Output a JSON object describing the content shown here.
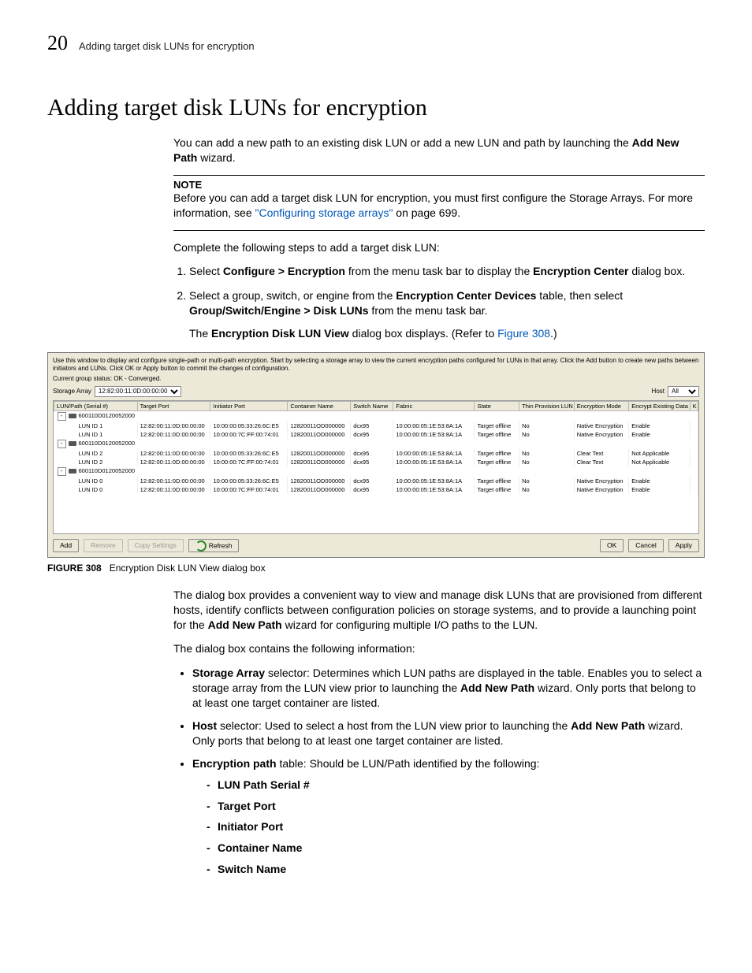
{
  "header": {
    "page_number": "20",
    "crumb": "Adding target disk LUNs for encryption"
  },
  "title": "Adding target disk LUNs for encryption",
  "intro": {
    "p1_a": "You can add a new path to an existing disk LUN or add a new LUN and path by launching the ",
    "p1_b": "Add New Path",
    "p1_c": " wizard."
  },
  "note": {
    "label": "NOTE",
    "text_a": "Before you can add a target disk LUN for encryption, you must first configure the Storage Arrays. For more information, see ",
    "link": "\"Configuring storage arrays\"",
    "text_b": " on page 699."
  },
  "complete": "Complete the following steps to add a target disk LUN:",
  "steps": {
    "s1_a": "Select ",
    "s1_b": "Configure > Encryption",
    "s1_c": " from the menu task bar to display the ",
    "s1_d": "Encryption Center",
    "s1_e": " dialog box.",
    "s2_a": "Select a group, switch, or engine from the ",
    "s2_b": "Encryption Center Devices",
    "s2_c": " table, then select ",
    "s2_d": "Group/Switch/Engine > Disk LUNs",
    "s2_e": " from the menu task bar.",
    "s2_sub_a": "The ",
    "s2_sub_b": "Encryption Disk LUN View",
    "s2_sub_c": " dialog box displays. (Refer to ",
    "s2_sub_link": "Figure 308",
    "s2_sub_d": ".)"
  },
  "dialog": {
    "instr": "Use this window to display and configure single-path or multi-path encryption. Start by selecting a storage array to view the current encryption paths configured for LUNs in that array. Click the Add button to create new paths between initiators and LUNs. Click OK or Apply button to commit the changes of configuration.",
    "status": "Current group status: OK - Converged.",
    "storage_array_label": "Storage Array",
    "storage_array_value": "12:82:00:11:0D:00:00:00",
    "host_label": "Host",
    "host_value": "All",
    "columns": [
      "LUN/Path (Serial #)",
      "Target Port",
      "Initiator Port",
      "Container Name",
      "Switch Name",
      "Fabric",
      "State",
      "Thin Provision LUN",
      "Encryption Mode",
      "Encrypt Existing Data",
      "K"
    ],
    "groups": [
      {
        "serial": "600110D0120052000",
        "rows": [
          {
            "lun": "LUN ID 1",
            "tp": "12:82:00:11:0D:00:00:00",
            "ip": "10:00:00:05:33:26:6C:E5",
            "cn": "12820011OD000000",
            "sw": "dcx95",
            "fab": "10:00:00:05:1E:53:8A:1A",
            "st": "Target offline",
            "thin": "No",
            "mode": "Native Encryption",
            "enc": "Enable"
          },
          {
            "lun": "LUN ID 1",
            "tp": "12:82:00:11:0D:00:00:00",
            "ip": "10:00:00:7C:FF:00:74:01",
            "cn": "12820011OD000000",
            "sw": "dcx95",
            "fab": "10:00:00:05:1E:53:8A:1A",
            "st": "Target offline",
            "thin": "No",
            "mode": "Native Encryption",
            "enc": "Enable"
          }
        ]
      },
      {
        "serial": "600110D0120052000",
        "rows": [
          {
            "lun": "LUN ID 2",
            "tp": "12:82:00:11:0D:00:00:00",
            "ip": "10:00:00:05:33:26:6C:E5",
            "cn": "12820011OD000000",
            "sw": "dcx95",
            "fab": "10:00:00:05:1E:53:8A:1A",
            "st": "Target offline",
            "thin": "No",
            "mode": "Clear Text",
            "enc": "Not Applicable"
          },
          {
            "lun": "LUN ID 2",
            "tp": "12:82:00:11:0D:00:00:00",
            "ip": "10:00:00:7C:FF:00:74:01",
            "cn": "12820011OD000000",
            "sw": "dcx95",
            "fab": "10:00:00:05:1E:53:8A:1A",
            "st": "Target offline",
            "thin": "No",
            "mode": "Clear Text",
            "enc": "Not Applicable"
          }
        ]
      },
      {
        "serial": "600110D0120052000",
        "rows": [
          {
            "lun": "LUN ID 0",
            "tp": "12:82:00:11:0D:00:00:00",
            "ip": "10:00:00:05:33:26:6C:E5",
            "cn": "12820011OD000000",
            "sw": "dcx95",
            "fab": "10:00:00:05:1E:53:8A:1A",
            "st": "Target offline",
            "thin": "No",
            "mode": "Native Encryption",
            "enc": "Enable"
          },
          {
            "lun": "LUN ID 0",
            "tp": "12:82:00:11:0D:00:00:00",
            "ip": "10:00:00:7C:FF:00:74:01",
            "cn": "12820011OD000000",
            "sw": "dcx95",
            "fab": "10:00:00:05:1E:53:8A:1A",
            "st": "Target offline",
            "thin": "No",
            "mode": "Native Encryption",
            "enc": "Enable"
          }
        ]
      }
    ],
    "buttons": {
      "add": "Add",
      "remove": "Remove",
      "copy": "Copy Settings",
      "refresh": "Refresh",
      "ok": "OK",
      "cancel": "Cancel",
      "apply": "Apply"
    }
  },
  "figure": {
    "label": "FIGURE 308",
    "caption": "Encryption Disk LUN View dialog box"
  },
  "post": {
    "p1_a": "The dialog box provides a convenient way to view and manage disk LUNs that are provisioned from different hosts, identify conflicts between configuration policies on storage systems, and to provide a launching point for the ",
    "p1_b": "Add New Path",
    "p1_c": " wizard for configuring multiple I/O paths to the LUN.",
    "p2": "The dialog box contains the following information:"
  },
  "bullets": {
    "b1": {
      "bold": "Storage Array",
      "rest_a": " selector: Determines which LUN paths are displayed in the table. Enables you to select a storage array from the LUN view prior to launching the ",
      "bold2": "Add New Path",
      "rest_b": " wizard. Only ports that belong to at least one target container are listed."
    },
    "b2": {
      "bold": "Host",
      "rest_a": " selector: Used to select a host from the LUN view prior to launching the ",
      "bold2": "Add New Path",
      "rest_b": " wizard. Only ports that belong to at least one target container are listed."
    },
    "b3": {
      "bold": "Encryption path",
      "rest": " table: Should be LUN/Path identified by the following:"
    },
    "dashes": [
      "LUN Path Serial #",
      "Target Port",
      "Initiator Port",
      "Container Name",
      "Switch Name"
    ]
  }
}
